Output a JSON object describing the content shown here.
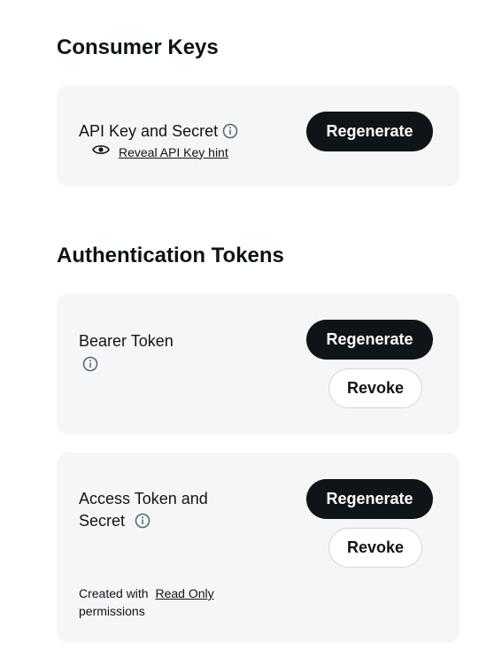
{
  "consumer_keys": {
    "title": "Consumer Keys",
    "api_key": {
      "label": "API Key and Secret",
      "reveal_link": "Reveal API Key hint",
      "regenerate_label": "Regenerate"
    }
  },
  "auth_tokens": {
    "title": "Authentication Tokens",
    "bearer": {
      "label": "Bearer Token",
      "regenerate_label": "Regenerate",
      "revoke_label": "Revoke"
    },
    "access": {
      "label_line1": "Access Token and",
      "label_line2": "Secret",
      "regenerate_label": "Regenerate",
      "revoke_label": "Revoke",
      "created_prefix": "Created with",
      "created_link": "Read Only",
      "created_suffix": "permissions"
    }
  },
  "icons": {
    "info": "info-circle-icon",
    "eye": "eye-icon"
  },
  "colors": {
    "card_bg": "#f5f7f7",
    "button_dark": "#0f1419",
    "text": "#0f1419"
  }
}
